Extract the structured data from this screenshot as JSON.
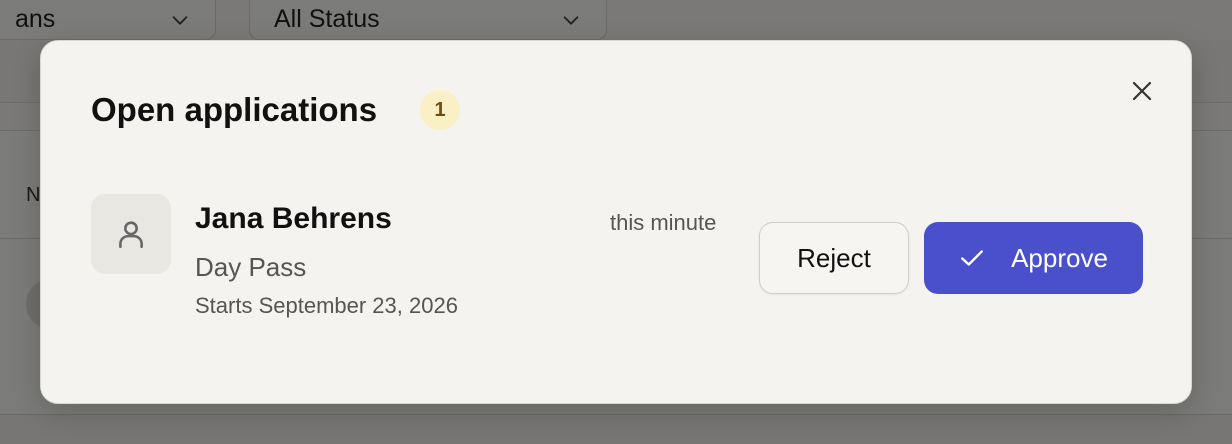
{
  "background": {
    "filter_plan": {
      "value": "ans"
    },
    "filter_status": {
      "value": "All Status"
    },
    "column_header": "N"
  },
  "modal": {
    "title": "Open applications",
    "count": "1",
    "close_icon": "close-icon",
    "applications": [
      {
        "avatar_icon": "user-icon",
        "name": "Jana Behrens",
        "plan": "Day Pass",
        "start": "Starts September 23, 2026",
        "time": "this minute",
        "reject_label": "Reject",
        "approve_label": "Approve",
        "approve_icon": "check-icon"
      }
    ]
  },
  "colors": {
    "accent": "#4a4fcc",
    "badge_bg": "#fbefc6",
    "modal_bg": "#f4f3ef"
  }
}
